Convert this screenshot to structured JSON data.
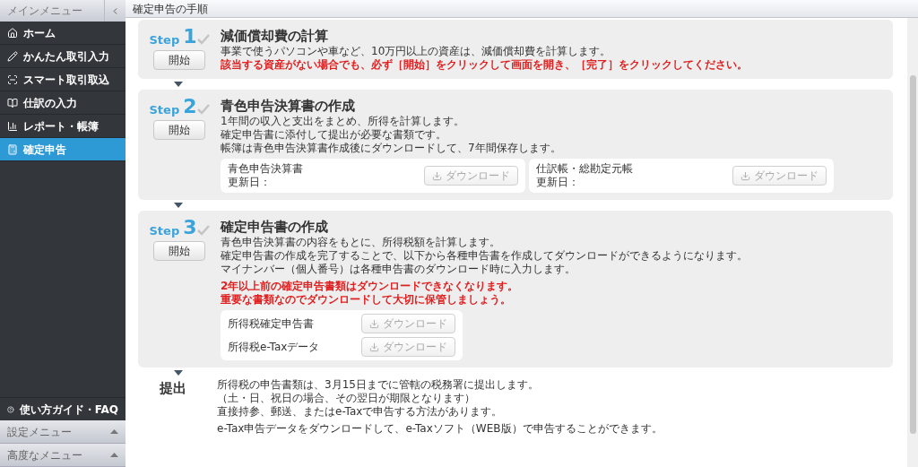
{
  "sidebar": {
    "title": "メインメニュー",
    "items": [
      {
        "label": "ホーム",
        "selected": false
      },
      {
        "label": "かんたん取引入力",
        "selected": false
      },
      {
        "label": "スマート取引取込",
        "selected": false
      },
      {
        "label": "仕訳の入力",
        "selected": false
      },
      {
        "label": "レポート・帳簿",
        "selected": false
      },
      {
        "label": "確定申告",
        "selected": true
      }
    ],
    "help": "使い方ガイド・FAQ",
    "sections": [
      {
        "label": "設定メニュー",
        "expanded": false
      },
      {
        "label": "高度なメニュー",
        "expanded": false
      }
    ]
  },
  "main": {
    "title": "確定申告の手順",
    "steps": [
      {
        "kind": "simple",
        "step_label": "Step",
        "number": "1",
        "button": "開始",
        "title": "減価償却費の計算",
        "lines": [
          "事業で使うパソコンや車など、10万円以上の資産は、減価償却費を計算します。"
        ],
        "warnings": [
          "該当する資産がない場合でも、必ず［開始］をクリックして画面を開き、［完了］をクリックしてください。"
        ]
      },
      {
        "kind": "split",
        "step_label": "Step",
        "number": "2",
        "button": "開始",
        "title": "青色申告決算書の作成",
        "lines": [
          "1年間の収入と支出をまとめ、所得を計算します。",
          "確定申告書に添付して提出が必要な書類です。",
          "帳簿は青色申告決算書作成後にダウンロードして、7年間保存します。"
        ],
        "downloads": [
          {
            "name": "青色申告決算書",
            "updated": "更新日：",
            "button": "ダウンロード",
            "disabled": true
          },
          {
            "name": "仕訳帳・総勘定元帳",
            "updated": "更新日：",
            "button": "ダウンロード",
            "disabled": true
          }
        ]
      },
      {
        "kind": "list",
        "step_label": "Step",
        "number": "3",
        "button": "開始",
        "title": "確定申告書の作成",
        "lines": [
          "青色申告決算書の内容をもとに、所得税額を計算します。",
          "確定申告書の作成を完了することで、以下から各種申告書を作成してダウンロードができるようになります。",
          "マイナンバー（個人番号）は各種申告書のダウンロード時に入力します。"
        ],
        "warnings": [
          "2年以上前の確定申告書類はダウンロードできなくなります。",
          "重要な書類なのでダウンロードして大切に保管しましょう。"
        ],
        "downloads": [
          {
            "name": "所得税確定申告書",
            "button": "ダウンロード",
            "disabled": true
          },
          {
            "name": "所得税e-Taxデータ",
            "button": "ダウンロード",
            "disabled": true
          }
        ]
      }
    ],
    "submit": {
      "title": "提出",
      "paragraphs": [
        [
          "所得税の申告書類は、3月15日までに管轄の税務署に提出します。",
          "（土・日、祝日の場合、その翌日が期限となります）",
          "直接持参、郵送、またはe-Taxで申告する方法があります。"
        ],
        [
          "e-Tax申告データをダウンロードして、e-Taxソフト（WEB版）で申告することができます。"
        ]
      ]
    }
  }
}
